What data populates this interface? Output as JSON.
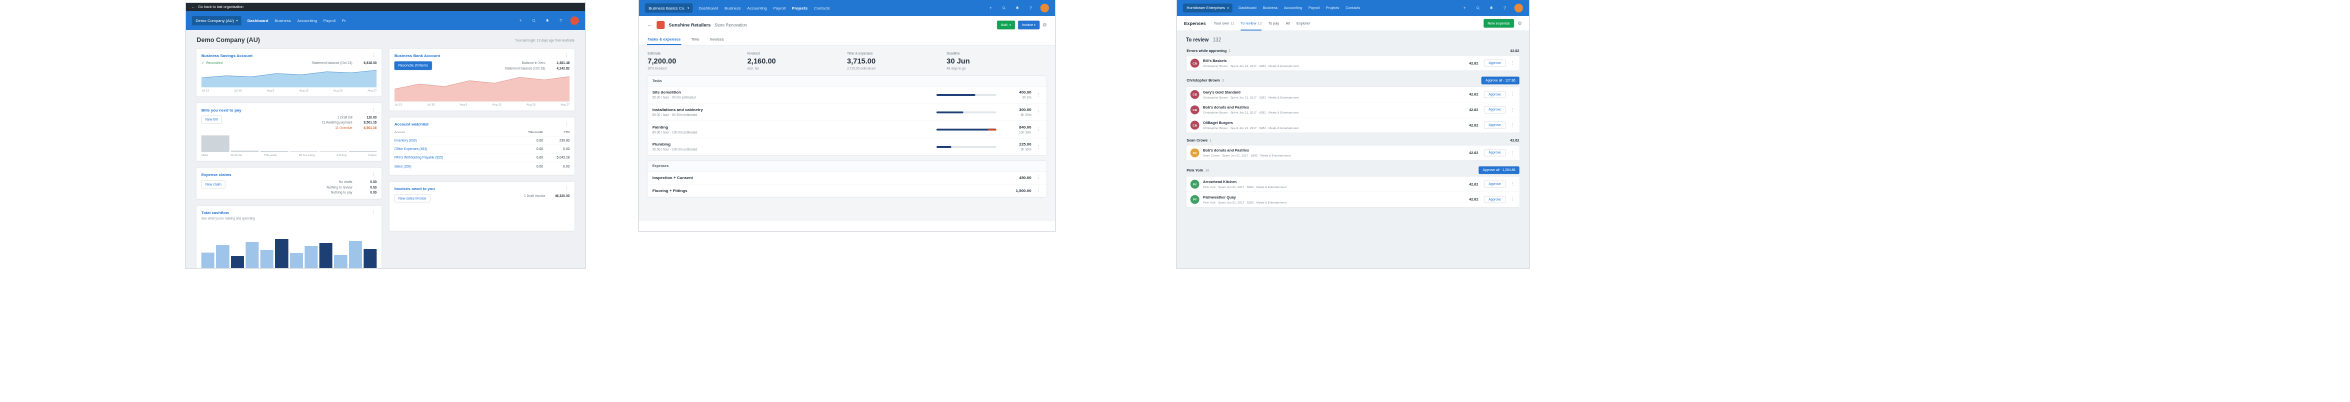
{
  "icons": {
    "back": "←",
    "caret": "▾",
    "plus": "+",
    "help": "?",
    "gear": "⚙",
    "kebab": "⋮",
    "check": "✓"
  },
  "colors": {
    "nav_blue": "#2277d2",
    "link_blue": "#2374d3",
    "green": "#11a353",
    "overdue_orange": "#d9652c",
    "savings_chart_fill": "#aed6f1",
    "bank_chart_fill": "#f5c6bf",
    "progress_navy": "#1d3f74",
    "progress_over_red": "#c9452c"
  },
  "dashboard": {
    "topbar": {
      "back_label": "Go back to last organisation"
    },
    "nav": {
      "org": "Demo Company (AU)",
      "items": [
        "Dashboard",
        "Business",
        "Accounting",
        "Payroll",
        "Pr"
      ]
    },
    "title": "Demo Company (AU)",
    "last_login": "Your last login: 13 days ago from Australia",
    "savings": {
      "title": "Business Savings Account",
      "reconciled": "Reconciled",
      "statement_label": "Statement balance (Oct 13)",
      "statement_value": "6,818.00",
      "spark": [
        38,
        46,
        42,
        55,
        50,
        62,
        58,
        68
      ],
      "ticks": [
        "Jul 23",
        "Jul 30",
        "Aug 6",
        "Aug 13",
        "Aug 20",
        "Aug 27"
      ]
    },
    "bank": {
      "title": "Business Bank Account",
      "reconcile_button": "Reconcile 20 items",
      "balance_label": "Balance in Xero",
      "balance_value": "2,361.48",
      "statement_label": "Statement balance (Oct 18)",
      "statement_value": "4,242.82",
      "spark": [
        30,
        42,
        36,
        50,
        44,
        58,
        52,
        60
      ],
      "ticks": [
        "Jul 23",
        "Jul 30",
        "Aug 6",
        "Aug 13",
        "Aug 20",
        "Aug 27"
      ]
    },
    "bills": {
      "title": "Bills you need to pay",
      "new_button": "New bill",
      "rows": [
        {
          "label": "1 Draft bill",
          "value": "110.00"
        },
        {
          "label": "11 Awaiting payment",
          "value": "8,501.16"
        },
        {
          "label": "11 Overdue",
          "value": "8,501.16"
        }
      ],
      "bars": [
        92,
        7,
        5,
        4,
        4,
        6
      ],
      "ticks": [
        "Older",
        "14-20 Jul",
        "This week",
        "26 Jul-1 Aug",
        "2-8 Aug",
        "Future"
      ]
    },
    "watchlist": {
      "title": "Account watchlist",
      "columns": [
        "Account",
        "This month",
        "YTD"
      ],
      "rows": [
        {
          "account": "Inventory (630)",
          "month": "0.00",
          "ytd": "239.80"
        },
        {
          "account": "Office Expenses (453)",
          "month": "0.00",
          "ytd": "0.00"
        },
        {
          "account": "PAYG Withholding Payable (825)",
          "month": "0.00",
          "ytd": "5,043.28"
        },
        {
          "account": "Sales (200)",
          "month": "0.00",
          "ytd": "0.00"
        }
      ]
    },
    "claims": {
      "title": "Expense claims",
      "new_button": "New claim",
      "rows": [
        {
          "label": "No drafts",
          "value": "0.00"
        },
        {
          "label": "Nothing to review",
          "value": "0.00"
        },
        {
          "label": "Nothing to pay",
          "value": "0.00"
        }
      ]
    },
    "cashflow": {
      "title": "Total cashflow",
      "subtitle": "See what you're making and spending",
      "bars": [
        45,
        60,
        38,
        66,
        50,
        72,
        44,
        58,
        64,
        40,
        68,
        52
      ]
    },
    "invoices": {
      "title": "Invoices owed to you",
      "new_button": "New sales invoice",
      "rows": [
        {
          "label": "1 Draft invoice",
          "value": "46,320.00"
        }
      ]
    }
  },
  "projects": {
    "nav": {
      "org": "Business Basics Co.",
      "items": [
        "Dashboard",
        "Business",
        "Accounting",
        "Payroll",
        "Projects",
        "Contacts"
      ]
    },
    "customer": "Sunshine Retailers",
    "project": "Store Renovation",
    "add_button": "Add",
    "invoice_button": "Invoice",
    "tabs": [
      "Tasks & expenses",
      "Time",
      "Invoices"
    ],
    "summary": [
      {
        "label": "Estimate",
        "value": "7,200.00",
        "sub": "30% invoiced"
      },
      {
        "label": "Invoiced",
        "value": "2,160.00",
        "sub": "excl. tax"
      },
      {
        "label": "Time & expenses",
        "value": "3,715.00",
        "sub": "3,715.00 uninvoiced"
      },
      {
        "label": "Deadline",
        "value": "30 Jun",
        "sub": "48 days to go"
      }
    ],
    "tasks_header": "Tasks",
    "tasks": [
      {
        "name": "Site demolition",
        "meta": "55.00 / hour · 9h 0m estimated",
        "amount": "400.00",
        "time": "9h 0m",
        "progress": 65
      },
      {
        "name": "Installations and cabinetry",
        "meta": "55.00 / hour · 8h 30m estimated",
        "amount": "300.00",
        "time": "5h 30m",
        "progress": 45
      },
      {
        "name": "Painting",
        "meta": "80.00 / hour · 10h 0m estimated",
        "amount": "840.00",
        "time": "10h 30m",
        "progress": 100
      },
      {
        "name": "Plumbing",
        "meta": "90.00 / hour · 10h 0m estimated",
        "amount": "225.00",
        "time": "2h 30m",
        "progress": 25
      }
    ],
    "expenses_header": "Expenses",
    "expense_rows": [
      {
        "name": "Inspection + Consent",
        "amount": "450.00"
      },
      {
        "name": "Flooring + Fittings",
        "amount": "1,500.00"
      }
    ]
  },
  "expenses": {
    "nav": {
      "org": "Hornblower Enterprises",
      "items": [
        "Dashboard",
        "Business",
        "Accounting",
        "Payroll",
        "Projects",
        "Contacts"
      ]
    },
    "title": "Expenses",
    "tabs": [
      {
        "label": "Your own",
        "count": "11"
      },
      {
        "label": "To review",
        "count": "13"
      },
      {
        "label": "To pay",
        "count": ""
      },
      {
        "label": "All",
        "count": ""
      },
      {
        "label": "Explorer",
        "count": ""
      }
    ],
    "new_button": "New expense",
    "heading": {
      "label": "To review",
      "count": "132"
    },
    "groups": [
      {
        "title": "Errors while approving",
        "count": "1",
        "total": "42.82",
        "approve_all": "",
        "rows": [
          {
            "initials": "CB",
            "color": "#b0485a",
            "name": "Bill's Baskets",
            "meta": "Christopher Brown · Spent Jun 21, 2017 · 6282 · Meals & Entertainment",
            "amount": "42.82",
            "action": "Approve"
          }
        ]
      },
      {
        "title": "Christopher Brown",
        "count": "3",
        "total": "",
        "approve_all": "Approve all · 127.86",
        "rows": [
          {
            "initials": "CB",
            "color": "#b0485a",
            "name": "Gary's Gold Standard",
            "meta": "Christopher Brown · Spent Jun 21, 2017 · 6282 · Meals & Entertainment",
            "amount": "42.62",
            "action": "Approve"
          },
          {
            "initials": "CB",
            "color": "#b0485a",
            "name": "Bob's donuts and Pastries",
            "meta": "Christopher Brown · Spent Jun 21, 2017 · 6282 · Meals & Entertainment",
            "amount": "42.62",
            "action": "Approve"
          },
          {
            "initials": "CB",
            "color": "#b0485a",
            "name": "OliBagel Burgers",
            "meta": "Christopher Brown · Spent Jun 21, 2017 · 6282 · Meals & Entertainment",
            "amount": "42.62",
            "action": "Approve"
          }
        ]
      },
      {
        "title": "Sean Crowe",
        "count": "1",
        "total": "42.62",
        "approve_all": "",
        "rows": [
          {
            "initials": "SC",
            "color": "#e2a23b",
            "name": "Bob's donuts and Pastries",
            "meta": "Sean Crowe · Spent Jun 21, 2017 · 6282 · Meals & Entertainment",
            "amount": "42.62",
            "action": "Approve"
          }
        ]
      },
      {
        "title": "Pink York",
        "count": "10",
        "total": "",
        "approve_all": "Approve all · 1,264.86",
        "rows": [
          {
            "initials": "PY",
            "color": "#3f9e63",
            "name": "Arrowhead Kitchen",
            "meta": "Pink York · Spent Jun 01, 2017 · 6282 · Meals & Entertainment",
            "amount": "42.62",
            "action": "Approve"
          },
          {
            "initials": "PY",
            "color": "#3f9e63",
            "name": "Palmweather Quay",
            "meta": "Pink York · Spent Jun 01, 2017 · 6282 · Meals & Entertainment",
            "amount": "42.62",
            "action": "Approve"
          }
        ]
      }
    ]
  }
}
